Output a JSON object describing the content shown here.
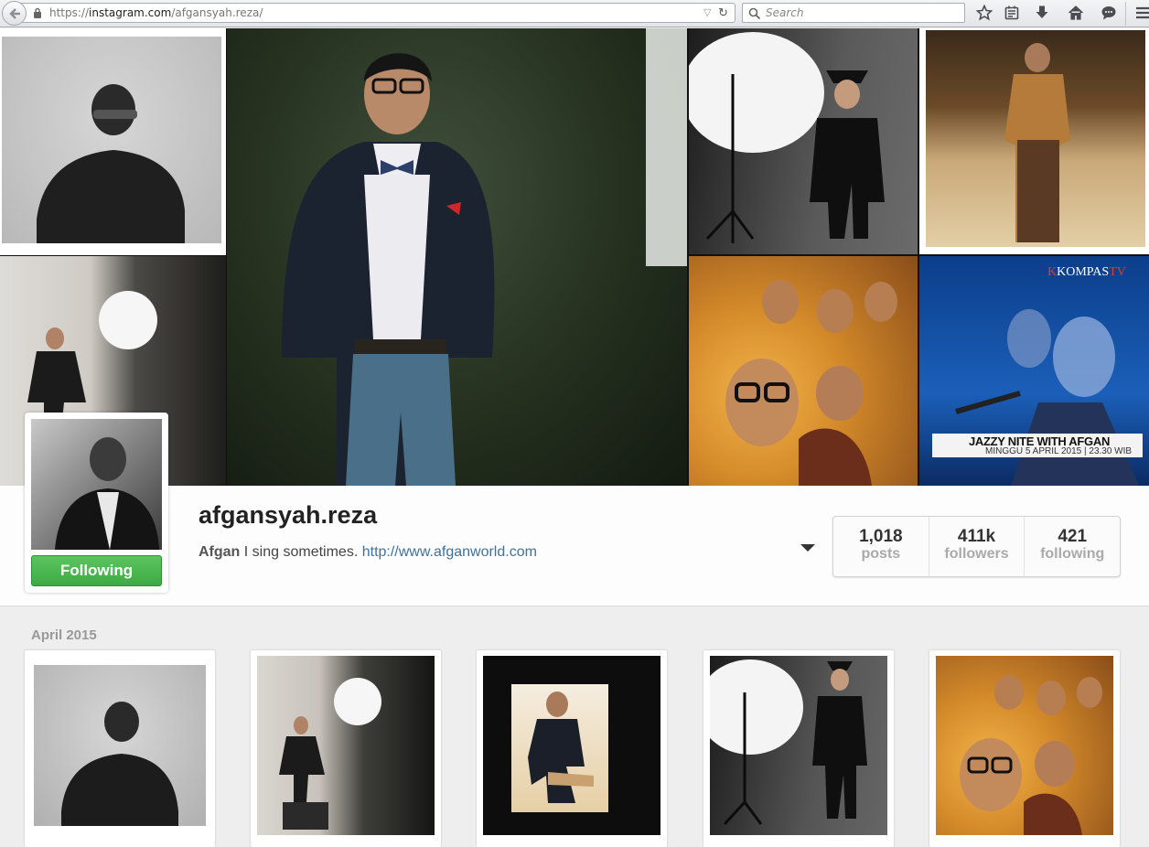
{
  "browser": {
    "url_prefix": "https://",
    "url_domain": "instagram.com",
    "url_path": "/afgansyah.reza/",
    "search_placeholder": "Search",
    "icons": [
      "back-arrow-icon",
      "lock-icon",
      "dropdown-icon",
      "reload-icon",
      "search-icon",
      "bookmark-star-icon",
      "reading-list-icon",
      "download-icon",
      "home-icon",
      "chat-icon",
      "menu-icon"
    ]
  },
  "mosaic": {
    "tv_logo_k": "K",
    "tv_logo_text": "KOMPAS",
    "tv_logo_tv": "TV",
    "lower_third_title": "JAZZY NITE WITH AFGAN",
    "lower_third_sub": "MINGGU 5 APRIL 2015 | 23.30 WIB"
  },
  "profile": {
    "username": "afgansyah.reza",
    "full_name": "Afgan",
    "bio": "I sing sometimes.",
    "website": "http://www.afganworld.com",
    "follow_button": "Following",
    "follow_color": "#4cb652",
    "stats": [
      {
        "value": "1,018",
        "label": "posts"
      },
      {
        "value": "411k",
        "label": "followers"
      },
      {
        "value": "421",
        "label": "following"
      }
    ]
  },
  "feed": {
    "month": "April 2015",
    "thumbnails": [
      "photo-1",
      "photo-2",
      "photo-3",
      "photo-4",
      "photo-5"
    ]
  }
}
